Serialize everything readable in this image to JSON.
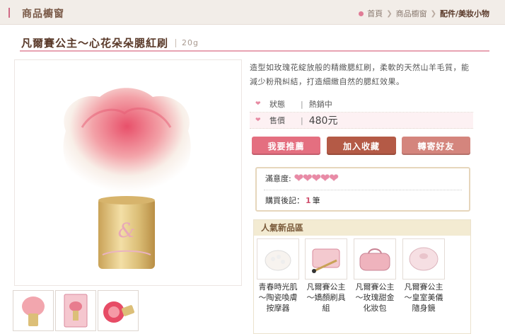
{
  "header": {
    "section_title": "商品櫥窗",
    "breadcrumb": {
      "home": "首頁",
      "level1": "商品櫥窗",
      "current": "配件/美妝小物"
    }
  },
  "product": {
    "title": "凡爾賽公主～心花朵朵腮紅刷",
    "weight": "20g",
    "description": "造型如玫瑰花綻放般的精緻腮紅刷，柔軟的天然山羊毛質，能減少粉飛糾結，打造細緻自然的腮紅效果。",
    "status_label": "狀態",
    "status_value": "熱銷中",
    "price_label": "售價",
    "price_value": "480元",
    "separator": "|"
  },
  "actions": {
    "recommend": "我要推薦",
    "favorite": "加入收藏",
    "share": "轉寄好友"
  },
  "rating": {
    "label": "滿意度:",
    "hearts": 5,
    "reviews_label": "購買後記：",
    "reviews_count": "1",
    "reviews_unit": "筆"
  },
  "new_products": {
    "title": "人氣新品區",
    "items": [
      {
        "name": "青春時光肌～陶瓷喚膚按摩器"
      },
      {
        "name": "凡爾賽公主～嬌顏刷具組"
      },
      {
        "name": "凡爾賽公主～玫瑰甜金化妝包"
      },
      {
        "name": "凡爾賽公主～皇室美儀隨身鏡"
      }
    ]
  },
  "colors": {
    "accent_pink": "#e46f80",
    "brown": "#b45a46",
    "title_line": "#e8a3b2"
  }
}
